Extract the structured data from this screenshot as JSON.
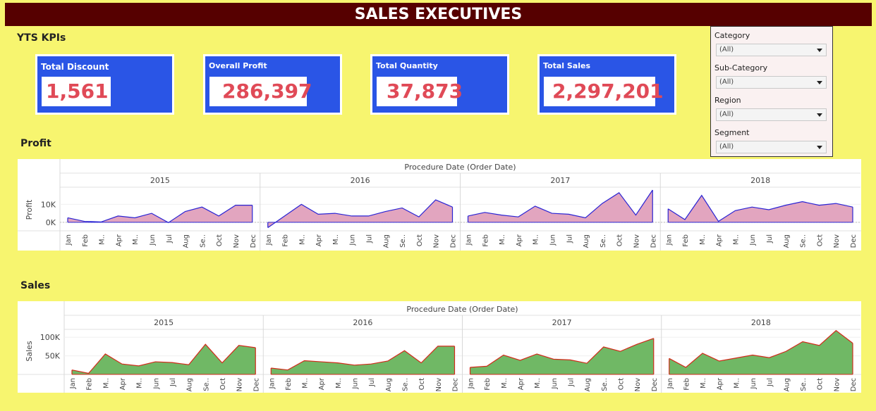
{
  "title": "SALES EXECUTIVES",
  "kpi_section_title": "YTS KPIs",
  "kpis": [
    {
      "label": "Total Discount",
      "value": "1,561"
    },
    {
      "label": "Overall Profit",
      "value": "286,397"
    },
    {
      "label": "Total Quantity",
      "value": "37,873"
    },
    {
      "label": "Total Sales",
      "value": "2,297,201"
    }
  ],
  "filters": [
    {
      "label": "Category",
      "value": "(All)"
    },
    {
      "label": "Sub-Category",
      "value": "(All)"
    },
    {
      "label": "Region",
      "value": "(All)"
    },
    {
      "label": "Segment",
      "value": "(All)"
    }
  ],
  "profit_section_title": "Profit",
  "sales_section_title": "Sales",
  "chart_data": [
    {
      "type": "area",
      "title": "Profit",
      "header": "Procedure Date (Order Date)",
      "ylabel": "Profit",
      "ylim": [
        -4000,
        18000
      ],
      "yticks": [
        0,
        10000
      ],
      "ytick_labels": [
        "0K",
        "10K"
      ],
      "years": [
        "2015",
        "2016",
        "2017",
        "2018"
      ],
      "months": [
        "Jan",
        "Feb",
        "M..",
        "Apr",
        "M..",
        "Jun",
        "Jul",
        "Aug",
        "Se..",
        "Oct",
        "Nov",
        "Dec"
      ],
      "series": [
        {
          "year": "2015",
          "values": [
            2500,
            500,
            200,
            3500,
            2500,
            5000,
            -200,
            6000,
            8500,
            3500,
            9500,
            9500
          ]
        },
        {
          "year": "2016",
          "values": [
            -3000,
            3500,
            10000,
            4500,
            5000,
            3500,
            3500,
            6000,
            8000,
            3000,
            12500,
            8500
          ]
        },
        {
          "year": "2017",
          "values": [
            3500,
            5500,
            4000,
            3000,
            9000,
            5000,
            4500,
            2500,
            10500,
            16500,
            4000,
            18000
          ]
        },
        {
          "year": "2018",
          "values": [
            7500,
            1500,
            15000,
            500,
            6500,
            8500,
            7000,
            9500,
            11500,
            9500,
            10500,
            8500
          ]
        }
      ],
      "colors": {
        "fill": "#e2a5bf",
        "line": "#2a24d4"
      }
    },
    {
      "type": "area",
      "title": "Sales",
      "header": "Procedure Date (Order Date)",
      "ylabel": "Sales",
      "ylim": [
        0,
        125000
      ],
      "yticks": [
        50000,
        100000
      ],
      "ytick_labels": [
        "50K",
        "100K"
      ],
      "years": [
        "2015",
        "2016",
        "2017",
        "2018"
      ],
      "months": [
        "Jan",
        "Feb",
        "M..",
        "Apr",
        "M..",
        "Jun",
        "Jul",
        "Aug",
        "Se..",
        "Oct",
        "Nov",
        "Dec"
      ],
      "series": [
        {
          "year": "2015",
          "values": [
            12000,
            3000,
            55000,
            28000,
            23000,
            34000,
            32000,
            26000,
            81000,
            31000,
            78000,
            72000
          ]
        },
        {
          "year": "2016",
          "values": [
            17000,
            12000,
            37000,
            34000,
            31000,
            25000,
            28000,
            36000,
            64000,
            31000,
            76000,
            76000
          ]
        },
        {
          "year": "2017",
          "values": [
            19000,
            22000,
            52000,
            38000,
            55000,
            41000,
            39000,
            30000,
            74000,
            62000,
            81000,
            97000
          ]
        },
        {
          "year": "2018",
          "values": [
            43000,
            19000,
            57000,
            36000,
            44000,
            52000,
            45000,
            62000,
            88000,
            78000,
            118000,
            84000
          ]
        }
      ],
      "colors": {
        "fill": "#70b865",
        "line": "#d22a1a"
      }
    }
  ]
}
